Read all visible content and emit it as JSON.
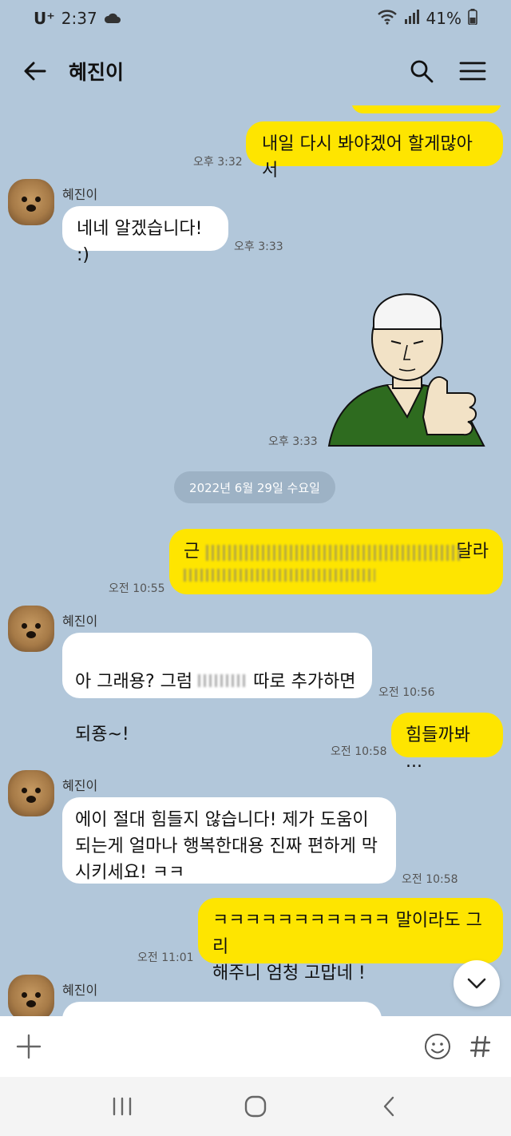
{
  "status_bar": {
    "carrier": "U⁺",
    "time": "2:37",
    "battery": "41%"
  },
  "header": {
    "title": "혜진이"
  },
  "messages": {
    "m1": {
      "text": "내일 다시 봐야겠어 할게많아서",
      "time": "오후 3:32"
    },
    "m2": {
      "sender": "혜진이",
      "text": "네네 알겠습니다! :)",
      "time": "오후 3:33"
    },
    "m3": {
      "sticker": "thumbs-up-man-sticker",
      "time": "오후 3:33"
    },
    "date_divider": "2022년 6월 29일 수요일",
    "m4": {
      "text_start": "근",
      "text_end": "달라",
      "time": "오전 10:55"
    },
    "m5": {
      "sender": "혜진이",
      "text_a": "아 그래용? 그럼 ",
      "text_b": " 따로 추가하면",
      "text_c": "되죵~!",
      "time": "오전 10:56"
    },
    "m6": {
      "text": "힘들까봐 ...",
      "time": "오전 10:58"
    },
    "m7": {
      "sender": "혜진이",
      "text": "에이 절대 힘들지 않습니다! 제가 도움이\n되는게 얼마나 행복한대용 진짜 편하게 막\n시키세요! ㅋㅋ",
      "time": "오전 10:58"
    },
    "m8": {
      "text": "ㅋㅋㅋㅋㅋㅋㅋㅋㅋㅋㅋ 말이라도 그리\n해주니 엄청 고맙네 !",
      "time": "오전 11:01"
    },
    "m9": {
      "sender": "혜진이"
    }
  },
  "input": {
    "placeholder": ""
  },
  "colors": {
    "background": "#b2c7da",
    "my_bubble": "#fee500",
    "other_bubble": "#ffffff"
  }
}
